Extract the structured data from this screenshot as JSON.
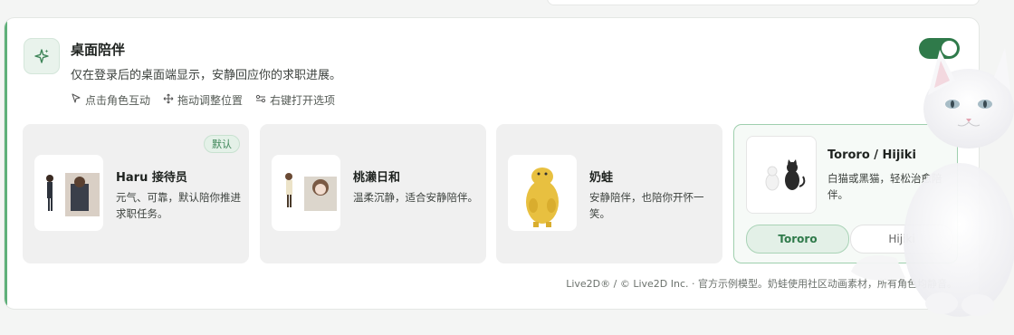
{
  "section": {
    "title": "桌面陪伴",
    "description": "仅在登录后的桌面端显示，安静回应你的求职进展。",
    "hints": [
      {
        "icon": "pointer-icon",
        "label": "点击角色互动"
      },
      {
        "icon": "move-icon",
        "label": "拖动调整位置"
      },
      {
        "icon": "options-icon",
        "label": "右键打开选项"
      }
    ],
    "enabled": true
  },
  "characters": [
    {
      "name": "Haru 接待员",
      "description": "元气、可靠，默认陪你推进求职任务。",
      "badge": "默认"
    },
    {
      "name": "桃濑日和",
      "description": "温柔沉静，适合安静陪伴。"
    },
    {
      "name": "奶蛙",
      "description": "安静陪伴，也陪你开怀一笑。"
    },
    {
      "name": "Tororo / Hijiki",
      "description": "白猫或黑猫，轻松治愈陪伴。",
      "variants": [
        "Tororo",
        "Hijiki"
      ],
      "selected_variant": "Tororo"
    }
  ],
  "footer": "Live2D® / © Live2D Inc. · 官方示例模型。奶蛙使用社区动画素材，所有角色均静音。",
  "colors": {
    "accent": "#2f7a4a",
    "accent_light": "#e4f1e8"
  }
}
